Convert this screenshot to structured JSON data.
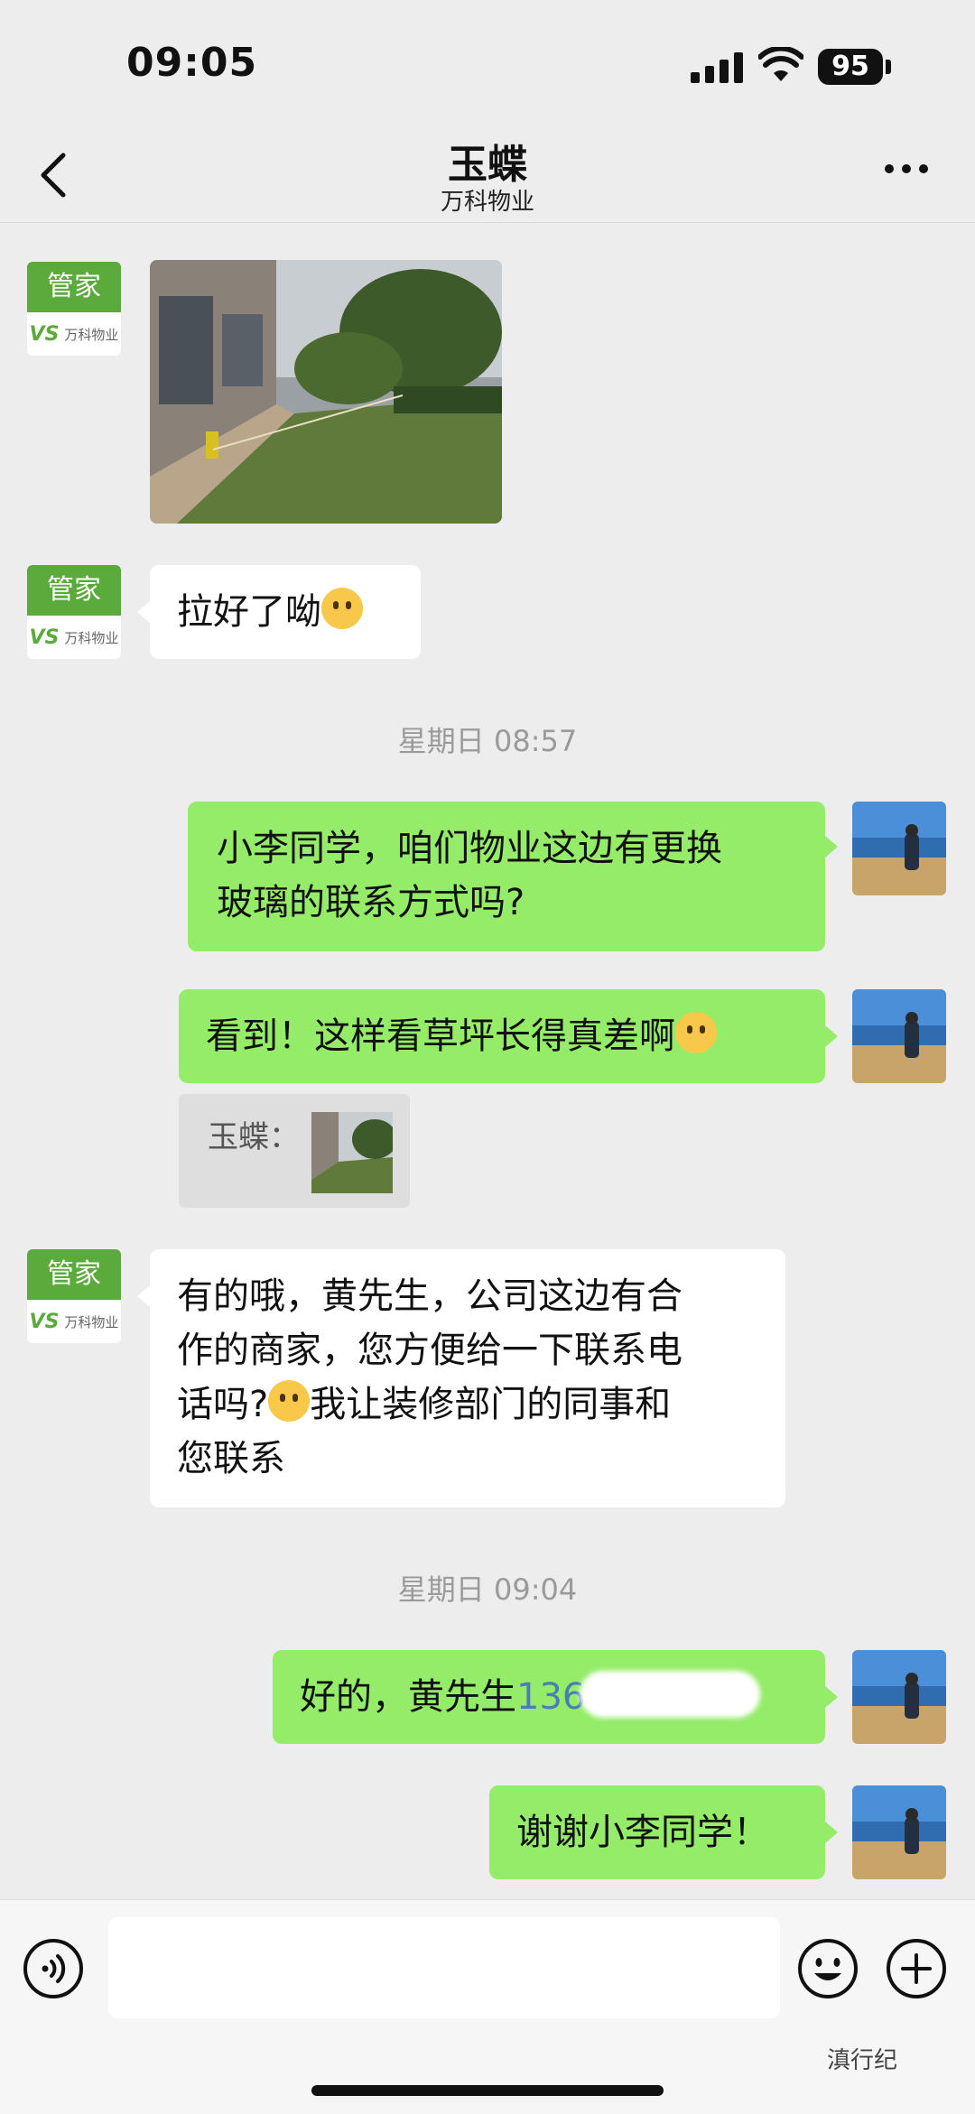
{
  "status": {
    "time": "09:05",
    "battery": "95"
  },
  "header": {
    "title": "玉蝶",
    "subtitle": "万科物业"
  },
  "steward_avatar": {
    "top_label": "管家",
    "logo": "VS",
    "company": "万科物业"
  },
  "messages": {
    "m2": {
      "text": "拉好了呦"
    },
    "ts1": "星期日 08:57",
    "m3": {
      "line1": "小李同学，咱们物业这边有更换",
      "line2": "玻璃的联系方式吗?"
    },
    "m4": {
      "text": "看到！这样看草坪长得真差啊"
    },
    "quote": {
      "label": "玉蝶："
    },
    "m5": {
      "line1": "有的哦，黄先生，公司这边有合",
      "line2": "作的商家，您方便给一下联系电",
      "line3a": "话吗?",
      "line3b": "我让装修部门的同事和",
      "line4": "您联系"
    },
    "ts2": "星期日 09:04",
    "m6": {
      "text": "好的，黄先生",
      "phone": "136"
    },
    "m7": {
      "text": "谢谢小李同学！"
    }
  },
  "watermark": "滇行纪",
  "icons": [
    "back-icon",
    "more-icon",
    "signal-icon",
    "wifi-icon",
    "voice-icon",
    "emoji-icon",
    "plus-icon"
  ]
}
